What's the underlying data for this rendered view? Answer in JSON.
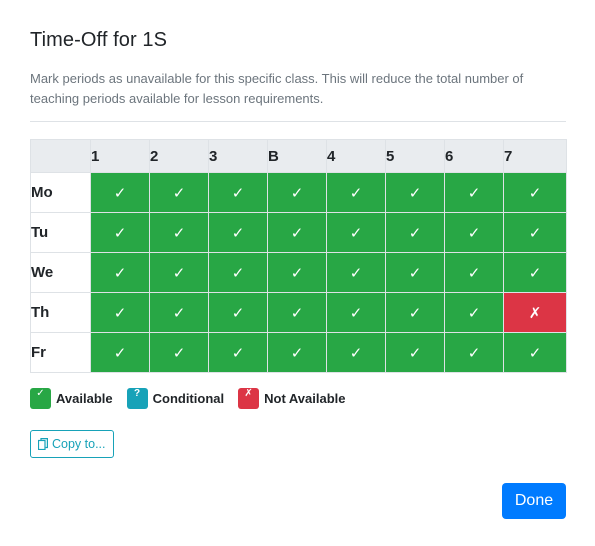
{
  "modal": {
    "title": "Time-Off for 1S",
    "description": "Mark periods as unavailable for this specific class. This will reduce the total number of teaching periods available for lesson requirements."
  },
  "grid": {
    "periods": [
      "1",
      "2",
      "3",
      "B",
      "4",
      "5",
      "6",
      "7"
    ],
    "rows": [
      {
        "day": "Mo",
        "cells": [
          "available",
          "available",
          "available",
          "available",
          "available",
          "available",
          "available",
          "available"
        ]
      },
      {
        "day": "Tu",
        "cells": [
          "available",
          "available",
          "available",
          "available",
          "available",
          "available",
          "available",
          "available"
        ]
      },
      {
        "day": "We",
        "cells": [
          "available",
          "available",
          "available",
          "available",
          "available",
          "available",
          "available",
          "available"
        ]
      },
      {
        "day": "Th",
        "cells": [
          "available",
          "available",
          "available",
          "available",
          "available",
          "available",
          "available",
          "unavailable"
        ]
      },
      {
        "day": "Fr",
        "cells": [
          "available",
          "available",
          "available",
          "available",
          "available",
          "available",
          "available",
          "available"
        ]
      }
    ],
    "symbols": {
      "available": "✓",
      "unavailable": "✗",
      "conditional": "?"
    }
  },
  "legend": {
    "available": {
      "label": "Available",
      "symbol": "✓",
      "color": "#28a745"
    },
    "conditional": {
      "label": "Conditional",
      "symbol": "?",
      "color": "#17a2b8"
    },
    "unavailable": {
      "label": "Not Available",
      "symbol": "✗",
      "color": "#dc3545"
    }
  },
  "actions": {
    "copy_label": "Copy to...",
    "copy_icon": "copy-icon",
    "done_label": "Done"
  }
}
